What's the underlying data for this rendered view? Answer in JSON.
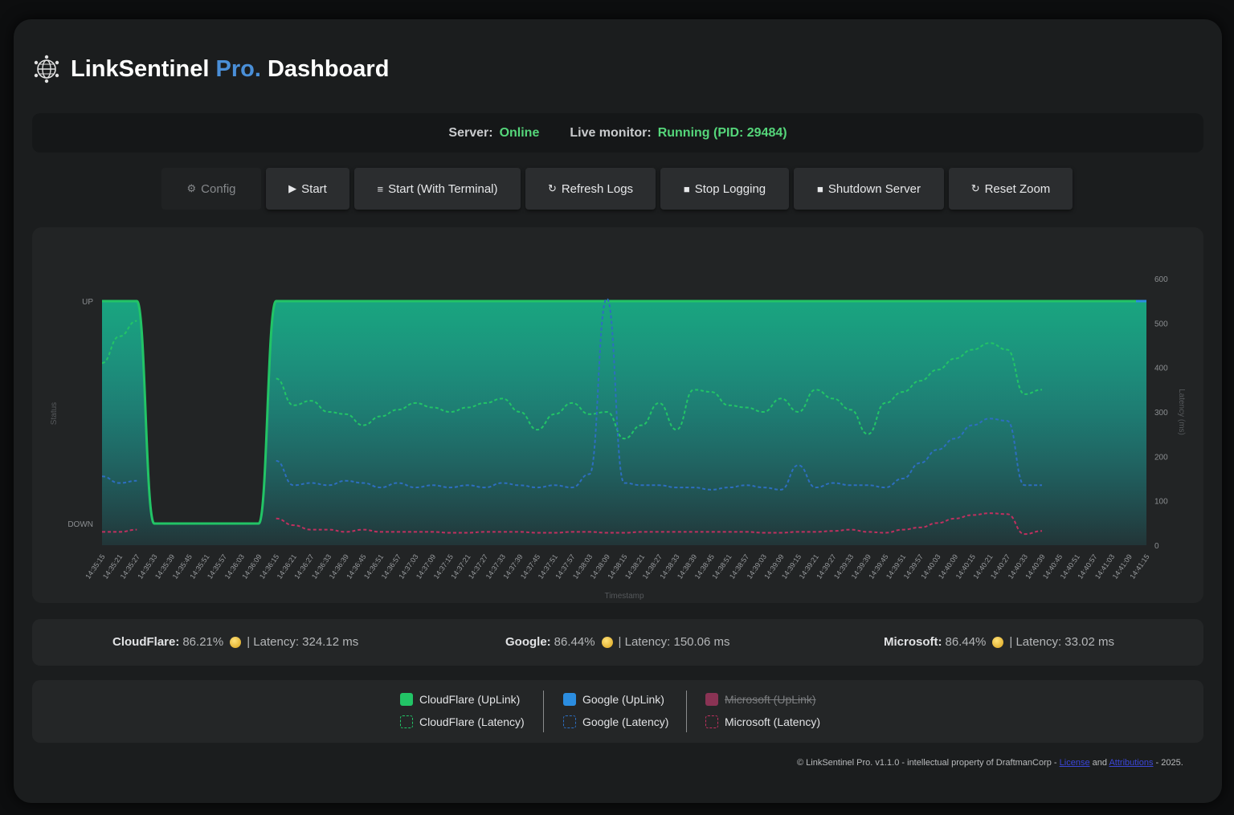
{
  "app": {
    "title_main": "LinkSentinel",
    "title_pro": "Pro.",
    "title_tail": "Dashboard",
    "logo_icon": "globe-network-icon"
  },
  "status": {
    "server_label": "Server:",
    "server_value": "Online",
    "monitor_label": "Live monitor:",
    "monitor_value": "Running (PID: 29484)",
    "ok_color": "#55d67a"
  },
  "toolbar": {
    "config": "Config",
    "start": "Start",
    "start_terminal": "Start (With Terminal)",
    "refresh_logs": "Refresh Logs",
    "stop_logging": "Stop Logging",
    "shutdown": "Shutdown Server",
    "reset_zoom": "Reset Zoom"
  },
  "chart_data": {
    "type": "line",
    "xlabel": "Timestamp",
    "ylabel_left": "Status",
    "ylabel_right": "Latency (ms)",
    "left_ticks": [
      "UP",
      "DOWN"
    ],
    "right_ticks": [
      0,
      100,
      200,
      300,
      400,
      500,
      600
    ],
    "ylim_right": [
      0,
      600
    ],
    "x": [
      "14:35:15",
      "14:35:21",
      "14:35:27",
      "14:35:33",
      "14:35:39",
      "14:35:45",
      "14:35:51",
      "14:35:57",
      "14:36:03",
      "14:36:09",
      "14:36:15",
      "14:36:21",
      "14:36:27",
      "14:36:33",
      "14:36:39",
      "14:36:45",
      "14:36:51",
      "14:36:57",
      "14:37:03",
      "14:37:09",
      "14:37:15",
      "14:37:21",
      "14:37:27",
      "14:37:33",
      "14:37:39",
      "14:37:45",
      "14:37:51",
      "14:37:57",
      "14:38:03",
      "14:38:09",
      "14:38:15",
      "14:38:21",
      "14:38:27",
      "14:38:33",
      "14:38:39",
      "14:38:45",
      "14:38:51",
      "14:38:57",
      "14:39:03",
      "14:39:09",
      "14:39:15",
      "14:39:21",
      "14:39:27",
      "14:39:33",
      "14:39:39",
      "14:39:45",
      "14:39:51",
      "14:39:57",
      "14:40:03",
      "14:40:09",
      "14:40:15",
      "14:40:21",
      "14:40:27",
      "14:40:33",
      "14:40:39",
      "14:40:45",
      "14:40:51",
      "14:40:57",
      "14:41:03",
      "14:41:09",
      "14:41:15"
    ],
    "series": [
      {
        "name": "CloudFlare (UpLink)",
        "kind": "status",
        "color": "#22c466",
        "values": [
          1,
          1,
          1,
          0,
          0,
          0,
          0,
          0,
          0,
          0,
          1,
          1,
          1,
          1,
          1,
          1,
          1,
          1,
          1,
          1,
          1,
          1,
          1,
          1,
          1,
          1,
          1,
          1,
          1,
          1,
          1,
          1,
          1,
          1,
          1,
          1,
          1,
          1,
          1,
          1,
          1,
          1,
          1,
          1,
          1,
          1,
          1,
          1,
          1,
          1,
          1,
          1,
          1,
          1,
          1,
          1,
          1,
          1,
          1,
          1,
          1
        ]
      },
      {
        "name": "Google (UpLink)",
        "kind": "status",
        "color": "#2b8de0",
        "values": [
          1,
          1,
          1,
          0,
          0,
          0,
          0,
          0,
          0,
          0,
          1,
          1,
          1,
          1,
          1,
          1,
          1,
          1,
          1,
          1,
          1,
          1,
          1,
          1,
          1,
          1,
          1,
          1,
          1,
          1,
          1,
          1,
          1,
          1,
          1,
          1,
          1,
          1,
          1,
          1,
          1,
          1,
          1,
          1,
          1,
          1,
          1,
          1,
          1,
          1,
          1,
          1,
          1,
          1,
          1,
          1,
          1,
          1,
          1,
          1,
          1
        ]
      },
      {
        "name": "Microsoft (UpLink)",
        "kind": "status",
        "color": "#c0305f",
        "hidden": true,
        "values": []
      },
      {
        "name": "CloudFlare (Latency)",
        "kind": "latency",
        "color": "#22c466",
        "values": [
          410,
          470,
          505,
          null,
          null,
          null,
          null,
          null,
          null,
          null,
          375,
          315,
          325,
          300,
          295,
          270,
          290,
          305,
          320,
          310,
          300,
          310,
          320,
          330,
          300,
          260,
          295,
          320,
          295,
          300,
          240,
          270,
          320,
          260,
          350,
          345,
          315,
          310,
          300,
          330,
          300,
          350,
          330,
          305,
          250,
          320,
          345,
          370,
          395,
          420,
          440,
          455,
          440,
          340,
          350,
          null,
          null,
          null,
          null,
          null,
          null
        ]
      },
      {
        "name": "Google (Latency)",
        "kind": "latency",
        "color": "#2d6ec0",
        "values": [
          155,
          140,
          145,
          null,
          null,
          null,
          null,
          null,
          null,
          null,
          190,
          135,
          140,
          135,
          145,
          140,
          130,
          140,
          130,
          135,
          130,
          135,
          130,
          140,
          135,
          130,
          135,
          130,
          160,
          555,
          140,
          135,
          135,
          130,
          130,
          125,
          130,
          135,
          130,
          125,
          180,
          130,
          140,
          135,
          135,
          130,
          150,
          185,
          215,
          240,
          270,
          285,
          280,
          135,
          135,
          null,
          null,
          null,
          null,
          null,
          null
        ]
      },
      {
        "name": "Microsoft (Latency)",
        "kind": "latency",
        "color": "#c0305f",
        "values": [
          30,
          30,
          35,
          null,
          null,
          null,
          null,
          null,
          null,
          null,
          60,
          45,
          35,
          35,
          30,
          35,
          30,
          30,
          30,
          30,
          28,
          28,
          30,
          30,
          30,
          28,
          28,
          30,
          30,
          28,
          28,
          30,
          30,
          30,
          30,
          30,
          30,
          30,
          28,
          28,
          30,
          30,
          32,
          35,
          30,
          28,
          35,
          40,
          50,
          60,
          68,
          72,
          70,
          25,
          32,
          null,
          null,
          null,
          null,
          null,
          null
        ]
      }
    ],
    "legend_position": "bottom",
    "grid": false
  },
  "stats": [
    {
      "name": "CloudFlare:",
      "uptime": "86.21%",
      "latency": "| Latency: 324.12 ms"
    },
    {
      "name": "Google:",
      "uptime": "86.44%",
      "latency": "| Latency: 150.06 ms"
    },
    {
      "name": "Microsoft:",
      "uptime": "86.44%",
      "latency": "| Latency: 33.02 ms"
    }
  ],
  "legend": {
    "cf_uplink": "CloudFlare (UpLink)",
    "cf_latency": "CloudFlare (Latency)",
    "g_uplink": "Google (UpLink)",
    "g_latency": "Google (Latency)",
    "ms_uplink": "Microsoft (UpLink)",
    "ms_latency": "Microsoft (Latency)"
  },
  "footer": {
    "text": "© LinkSentinel Pro. v1.1.0 - intellectual property of DraftmanCorp -",
    "link1": "License",
    "and": "and",
    "link2": "Attributions",
    "tail": "- 2025."
  }
}
